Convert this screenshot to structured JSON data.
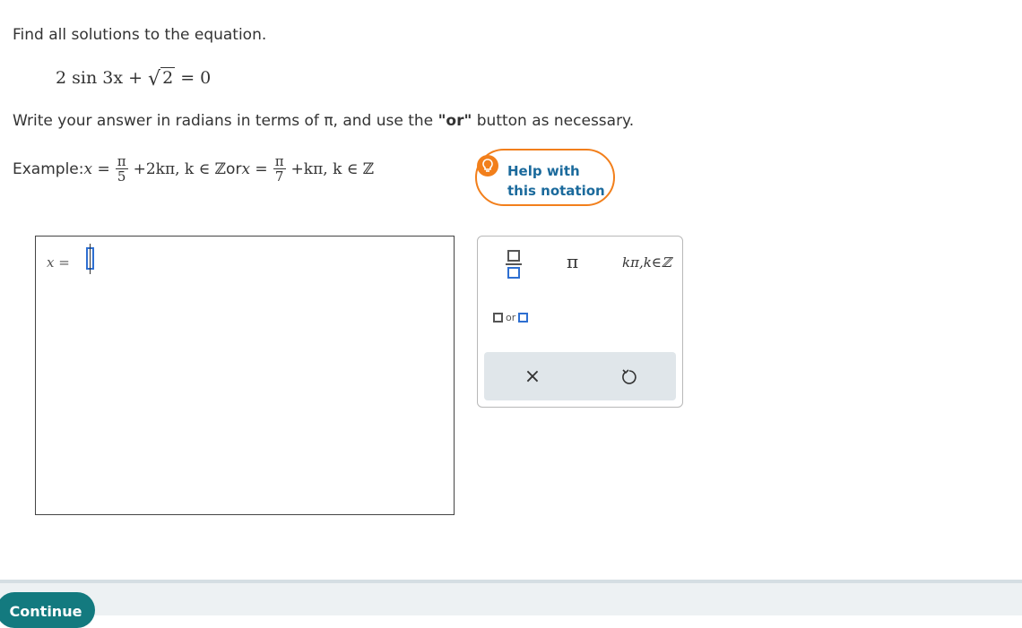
{
  "question": {
    "prompt": "Find all solutions to the equation.",
    "equation": {
      "lhs": "2 sin 3x + ",
      "radical_arg": "2",
      "rhs": " = 0"
    },
    "instructions_before": "Write your answer in radians in terms of π, and use the ",
    "instructions_bold": "\"or\"",
    "instructions_after": " button as necessary.",
    "example": {
      "label": "Example: ",
      "x_eq_1": "x = ",
      "frac1_num": "π",
      "frac1_den": "5",
      "term1": "+2kπ, k ∈ ℤ",
      "or_text": " or ",
      "x_eq_2": "x = ",
      "frac2_num": "π",
      "frac2_den": "7",
      "term2": "+kπ, k ∈ ℤ"
    }
  },
  "help": {
    "line1": "Help with",
    "line2": "this notation",
    "icon": "lightbulb-icon"
  },
  "answer": {
    "label": "x =",
    "value": ""
  },
  "palette": {
    "fraction_icon": "fraction-icon",
    "pi_label": "π",
    "kpi_label": "kπ,k∈ℤ",
    "or_label": "or",
    "clear_icon": "×",
    "undo_icon": "undo-icon"
  },
  "footer": {
    "continue_label": "Continue"
  },
  "colors": {
    "accent_orange": "#f27f1b",
    "link_blue": "#1b6a9c",
    "cursor_blue": "#2e6fd1",
    "continue_teal": "#137a7f"
  }
}
